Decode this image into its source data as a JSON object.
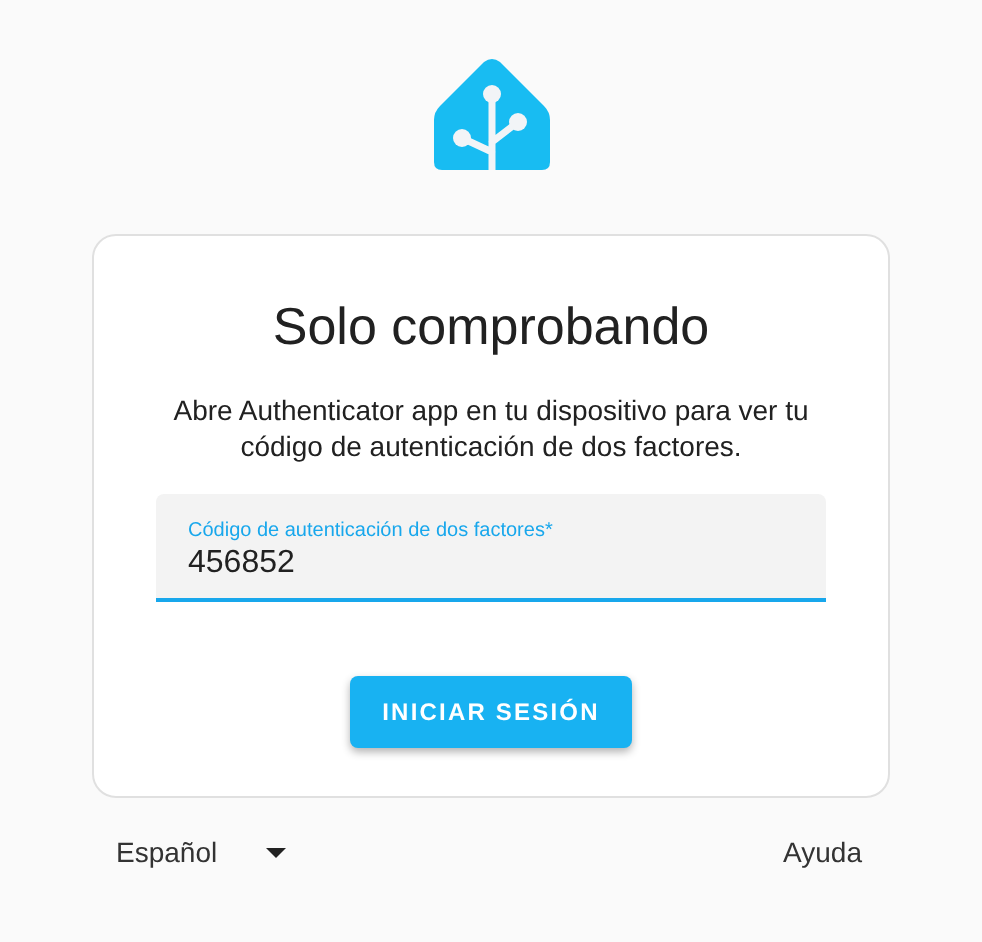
{
  "title": "Solo comprobando",
  "description": "Abre Authenticator app en tu dispositivo para ver tu código de autenticación de dos factores.",
  "code_field": {
    "label": "Código de autenticación de dos factores*",
    "value": "456852",
    "focused": true
  },
  "submit_button": "INICIAR SESIÓN",
  "footer": {
    "language": "Español",
    "help": "Ayuda"
  }
}
